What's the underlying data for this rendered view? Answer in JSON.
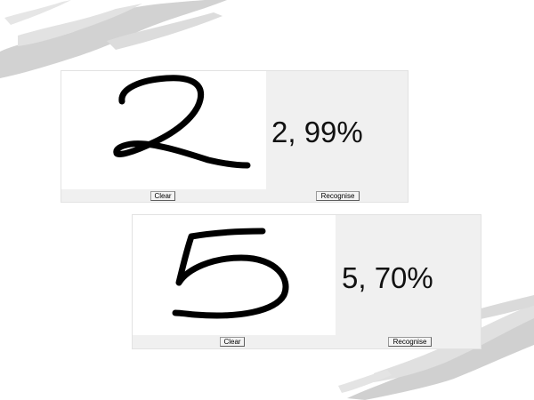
{
  "app1": {
    "result_text": "2, 99%",
    "clear_label": "Clear",
    "recognise_label": "Recognise"
  },
  "app2": {
    "result_text": "5, 70%",
    "clear_label": "Clear",
    "recognise_label": "Recognise"
  }
}
